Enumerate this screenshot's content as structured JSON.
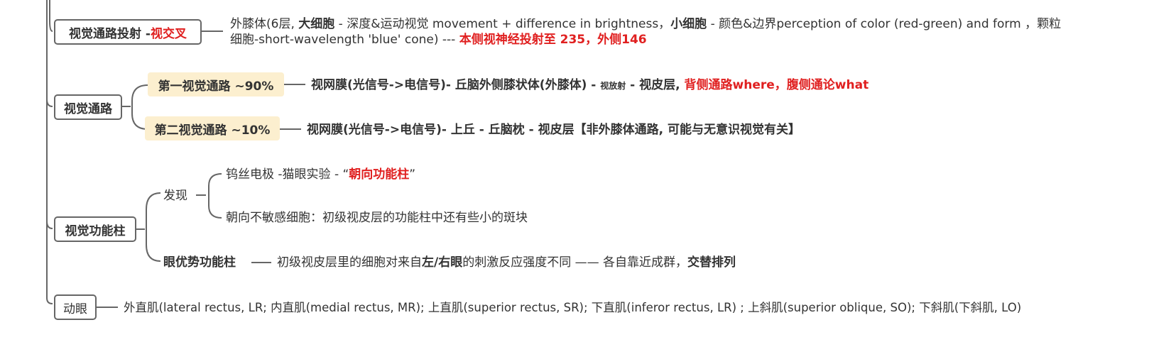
{
  "colors": {
    "accent_red": "#e02020",
    "highlight": "#fcefcf",
    "line": "#666666",
    "text": "#333333"
  },
  "projection": {
    "label": "视觉通路投射 - ",
    "label_red": "视交叉",
    "l1_a": "外膝体(6层, ",
    "l1_b": "大细胞",
    "l1_c": " - 深度&运动视觉 movement + difference in brightness，",
    "l1_d": "小细胞",
    "l1_e": " - 颜色&边界perception of color (red-green) and form ，颗粒",
    "l2_a": "细胞-short-wavelength 'blue' cone) --- ",
    "l2_b": "本侧视神经投射至 235，外侧146"
  },
  "pathway": {
    "label": "视觉通路",
    "first": {
      "label": "第一视觉通路 ~90%",
      "t1": "视网膜(光信号->电信号)- 丘脑外侧膝状体(外膝体) - ",
      "t2": "视放射",
      "t3": " - 视皮层, ",
      "t4": "背侧通路where，腹侧通论what"
    },
    "second": {
      "label": "第二视觉通路 ~10%",
      "t1": "视网膜(光信号->电信号)- 上丘 - 丘脑枕 - 视皮层【非外膝体通路, 可能与无意识视觉有关】"
    }
  },
  "column": {
    "label": "视觉功能柱",
    "discover": "发现",
    "d1_a": "钨丝电极 -猫眼实验 -   “",
    "d1_b": "朝向功能柱",
    "d1_c": "”",
    "d2": "朝向不敏感细胞：初级视皮层的功能柱中还有些小的斑块",
    "ocular_label": "眼优势功能柱",
    "o_a": "初级视皮层里的细胞对来自",
    "o_b": "左/右眼",
    "o_c": "的刺激反应强度不同 —— 各自靠近成群，",
    "o_d": "交替排列"
  },
  "eye": {
    "label": "动眼",
    "text": "外直肌(lateral rectus, LR;  内直肌(medial rectus, MR);  上直肌(superior rectus, SR);  下直肌(inferor rectus, LR) ;  上斜肌(superior oblique, SO);  下斜肌(下斜肌, LO)"
  }
}
